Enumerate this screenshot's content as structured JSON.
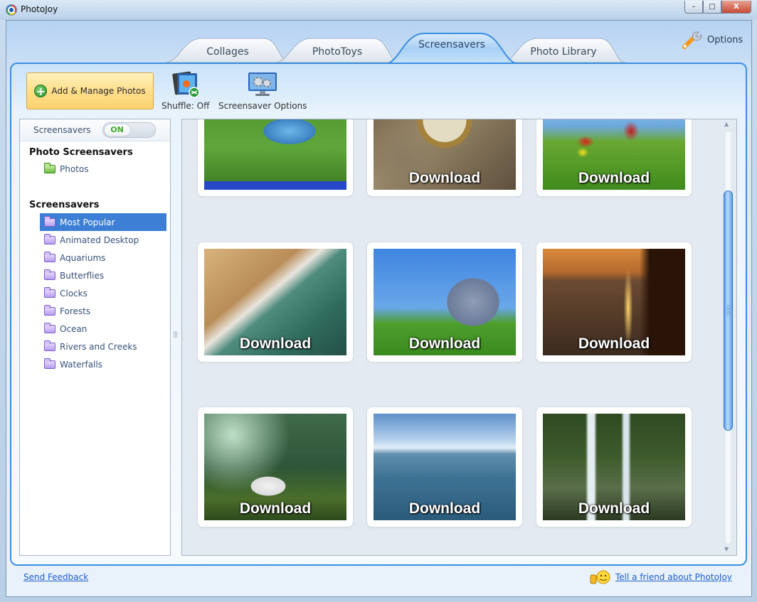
{
  "window": {
    "title": "PhotoJoy",
    "controls": {
      "minimize": "–",
      "maximize": "□",
      "close": "X"
    }
  },
  "tabs": [
    {
      "label": "Collages",
      "active": false
    },
    {
      "label": "PhotoToys",
      "active": false
    },
    {
      "label": "Screensavers",
      "active": true
    },
    {
      "label": "Photo Library",
      "active": false
    }
  ],
  "options": {
    "label": "Options",
    "icon": "wrench-icon"
  },
  "toolbar": {
    "add_manage_label": "Add & Manage Photos",
    "shuffle_label": "Shuffle: Off",
    "screensaver_options_label": "Screensaver Options"
  },
  "sidebar": {
    "toggle_label": "Screensavers",
    "toggle_state": "ON",
    "photo_section_title": "Photo Screensavers",
    "photo_items": [
      {
        "label": "Photos"
      }
    ],
    "screensaver_section_title": "Screensavers",
    "items": [
      {
        "label": "Most Popular",
        "selected": true
      },
      {
        "label": "Animated Desktop",
        "selected": false
      },
      {
        "label": "Aquariums",
        "selected": false
      },
      {
        "label": "Butterflies",
        "selected": false
      },
      {
        "label": "Clocks",
        "selected": false
      },
      {
        "label": "Forests",
        "selected": false
      },
      {
        "label": "Ocean",
        "selected": false
      },
      {
        "label": "Rivers and Creeks",
        "selected": false
      },
      {
        "label": "Waterfalls",
        "selected": false
      }
    ]
  },
  "gallery": {
    "items": [
      {
        "subject": "aquarium-fish",
        "label": ""
      },
      {
        "subject": "pocket-watch-on-stones",
        "label": "Download"
      },
      {
        "subject": "butterflies-on-meadow",
        "label": "Download"
      },
      {
        "subject": "beach-shoreline",
        "label": "Download"
      },
      {
        "subject": "cartoon-dolphin",
        "label": "Download"
      },
      {
        "subject": "ocean-sunset-cliff",
        "label": "Download"
      },
      {
        "subject": "unicorn-in-forest",
        "label": "Download"
      },
      {
        "subject": "open-ocean",
        "label": "Download"
      },
      {
        "subject": "forest-waterfall",
        "label": "Download"
      }
    ],
    "scroll_position": 0.35
  },
  "footer": {
    "feedback_label": "Send Feedback",
    "tell_friend_label": "Tell a friend about PhotoJoy"
  }
}
